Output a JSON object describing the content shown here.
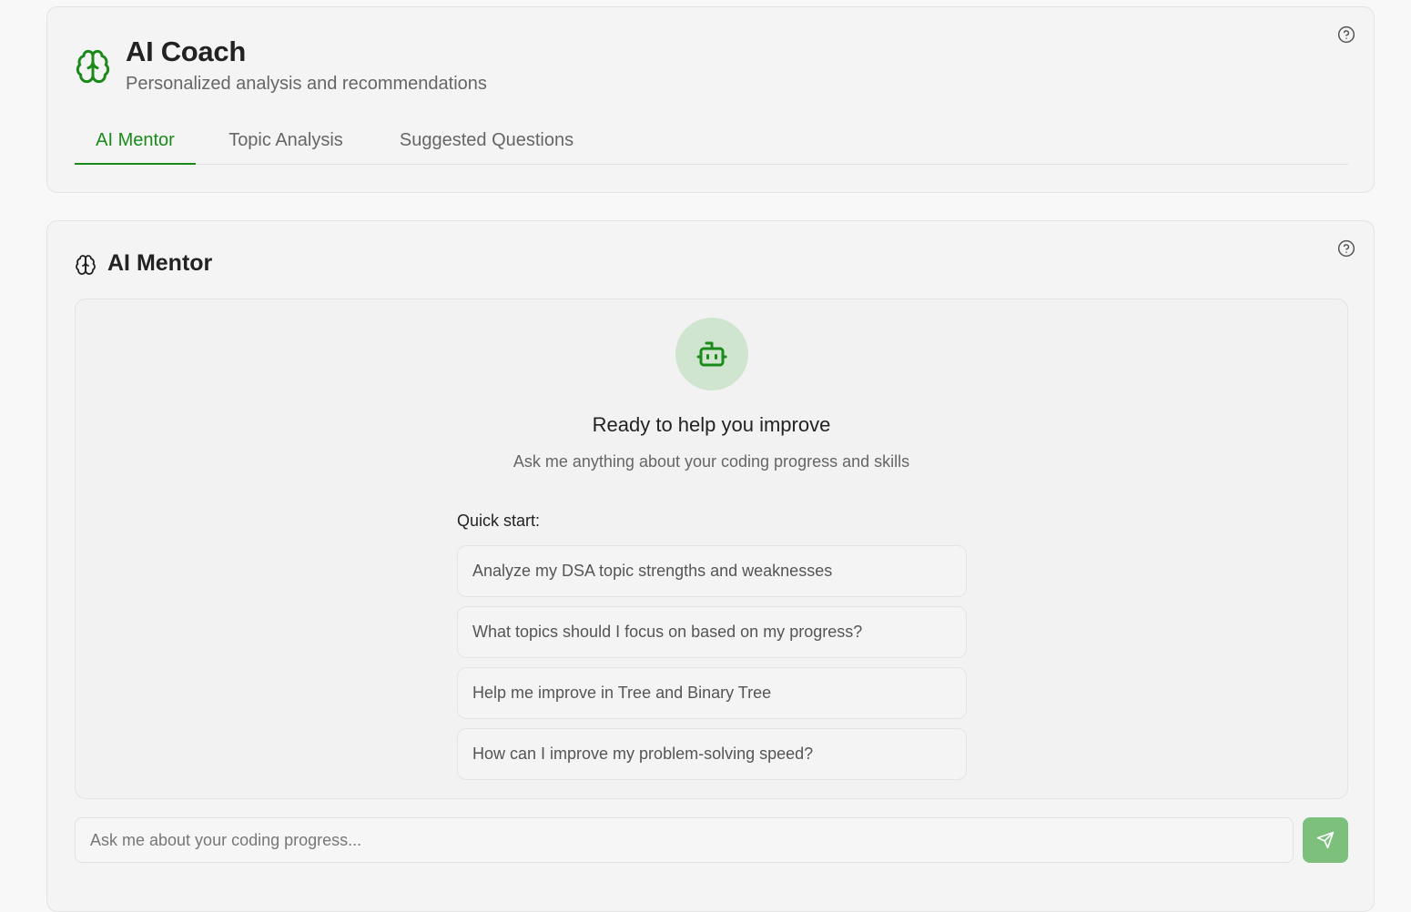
{
  "header": {
    "title": "AI Coach",
    "subtitle": "Personalized analysis and recommendations",
    "icon": "brain-icon",
    "help_icon": "help-circle-icon"
  },
  "tabs": [
    {
      "label": "AI Mentor",
      "active": true
    },
    {
      "label": "Topic Analysis",
      "active": false
    },
    {
      "label": "Suggested Questions",
      "active": false
    }
  ],
  "mentor": {
    "title": "AI Mentor",
    "icon": "brain-icon",
    "help_icon": "help-circle-icon",
    "avatar_icon": "bot-icon",
    "ready_title": "Ready to help you improve",
    "ready_subtitle": "Ask me anything about your coding progress and skills",
    "quick_start_label": "Quick start:",
    "suggestions": [
      "Analyze my DSA topic strengths and weaknesses",
      "What topics should I focus on based on my progress?",
      "Help me improve in Tree and Binary Tree",
      "How can I improve my problem-solving speed?"
    ],
    "input_placeholder": "Ask me about your coding progress...",
    "send_icon": "send-icon"
  },
  "colors": {
    "accent": "#1a8a1a",
    "accent_light": "#cfe5cf",
    "send_button": "#7cc07c"
  }
}
